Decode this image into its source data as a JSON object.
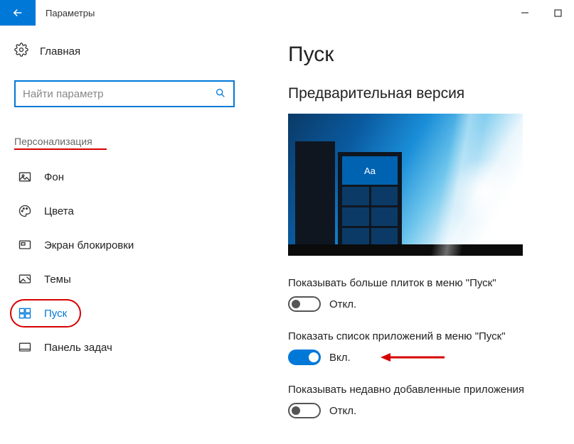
{
  "window": {
    "title": "Параметры"
  },
  "home": {
    "label": "Главная"
  },
  "search": {
    "placeholder": "Найти параметр"
  },
  "section": {
    "title": "Персонализация"
  },
  "nav": {
    "background": "Фон",
    "colors": "Цвета",
    "lockscreen": "Экран блокировки",
    "themes": "Темы",
    "start": "Пуск",
    "taskbar": "Панель задач"
  },
  "main": {
    "heading": "Пуск",
    "preview_title": "Предварительная версия",
    "preview_tile": "Aa"
  },
  "settings": {
    "more_tiles": {
      "label": "Показывать больше плиток в меню \"Пуск\"",
      "state": "Откл.",
      "on": false
    },
    "app_list": {
      "label": "Показать список приложений в меню \"Пуск\"",
      "state": "Вкл.",
      "on": true
    },
    "recent_apps": {
      "label": "Показывать недавно добавленные приложения",
      "state": "Откл.",
      "on": false
    }
  }
}
